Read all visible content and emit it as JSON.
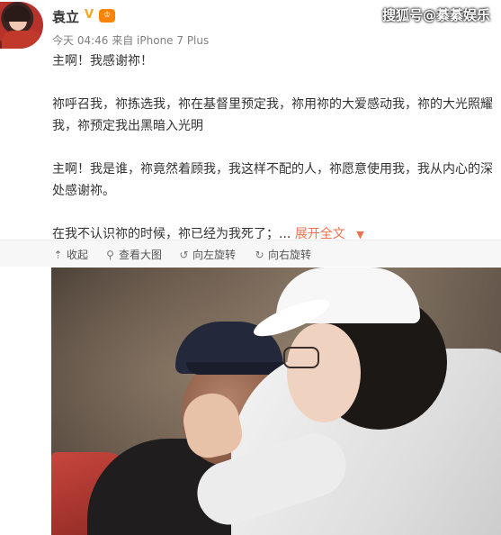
{
  "post": {
    "username": "袁立",
    "verified_icon": "verified-badge-icon",
    "vip_badge": "vip-icon",
    "timestamp": "今天 04:46",
    "source": "来自 iPhone 7 Plus",
    "watermark": "搜狐号@綦綦娱乐"
  },
  "content": {
    "paragraphs": [
      "主啊！我感谢祢！",
      "祢呼召我，祢拣选我，祢在基督里预定我，祢用祢的大爱感动我，祢的大光照耀我，祢预定我出黑暗入光明",
      "主啊！我是谁，祢竟然着顾我，我这样不配的人，祢愿意使用我，我从内心的深处感谢祢。",
      "在我不认识祢的时候，祢已经为我死了；..."
    ],
    "expand_label": "展开全文",
    "expand_icon": "chevron-down-icon"
  },
  "toolbar": {
    "collapse_label": "收起",
    "view_large_label": "查看大图",
    "rotate_left_label": "向左旋转",
    "rotate_right_label": "向右旋转",
    "icons": [
      "arrow-up-icon",
      "magnifier-icon",
      "rotate-left-icon",
      "rotate-right-icon"
    ]
  },
  "colors": {
    "link": "#eb7350",
    "text": "#333333",
    "meta": "#808080",
    "toolbar_bg": "#f7f7f7"
  }
}
